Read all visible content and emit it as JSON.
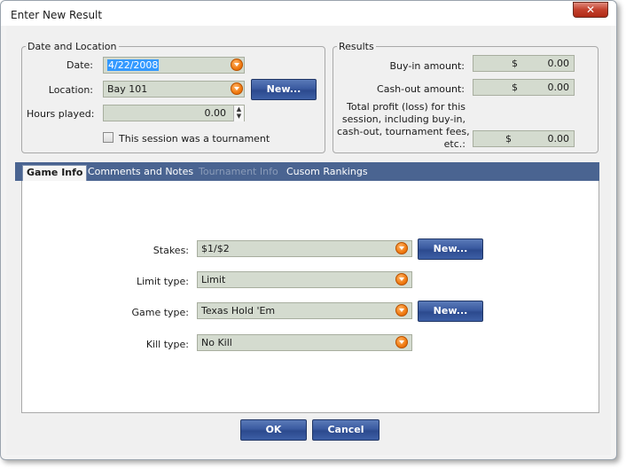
{
  "window": {
    "title": "Enter New Result",
    "close_label": "✕"
  },
  "date_location": {
    "legend": "Date and Location",
    "date_label": "Date:",
    "date_value": "4/22/2008",
    "location_label": "Location:",
    "location_value": "Bay 101",
    "new_label": "New...",
    "hours_label": "Hours played:",
    "hours_value": "0.00",
    "tournament_label": "This session was a tournament",
    "tournament_checked": false
  },
  "results": {
    "legend": "Results",
    "buyin_label": "Buy-in amount:",
    "buyin_currency": "$",
    "buyin_value": "0.00",
    "cashout_label": "Cash-out amount:",
    "cashout_currency": "$",
    "cashout_value": "0.00",
    "profit_label_lines": [
      "Total profit (loss) for this",
      "session, including buy-in,",
      "cash-out, tournament fees,",
      "etc.:"
    ],
    "profit_currency": "$",
    "profit_value": "0.00"
  },
  "tabs": [
    {
      "label": "Game Info",
      "state": "active"
    },
    {
      "label": "Comments and Notes",
      "state": "normal"
    },
    {
      "label": "Tournament Info",
      "state": "disabled"
    },
    {
      "label": "Cusom Rankings",
      "state": "normal"
    }
  ],
  "game_info": {
    "stakes_label": "Stakes:",
    "stakes_value": "$1/$2",
    "stakes_new_label": "New...",
    "limit_label": "Limit type:",
    "limit_value": "Limit",
    "game_label": "Game type:",
    "game_value": "Texas Hold 'Em",
    "game_new_label": "New...",
    "kill_label": "Kill type:",
    "kill_value": "No Kill"
  },
  "footer": {
    "ok_label": "OK",
    "cancel_label": "Cancel"
  },
  "colors": {
    "accent": "#3a5aa0",
    "tabbar": "#4a6491",
    "field_bg": "#d4dbcf",
    "dropdown_button": "#f07a10",
    "close_button": "#c3402c"
  },
  "icons": {
    "dropdown": "chevron-down-icon",
    "close": "close-icon",
    "spin_up": "arrow-up-icon",
    "spin_down": "arrow-down-icon"
  }
}
